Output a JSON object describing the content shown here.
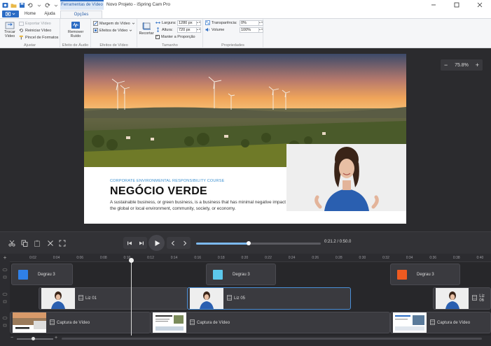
{
  "titlebar": {
    "context_tab": "Ferramentas de Vídeo",
    "app_title": "Novo Projeto - iSpring Cam Pro"
  },
  "tabs": [
    {
      "label": "Home"
    },
    {
      "label": "Ajuda"
    },
    {
      "label": "Opções"
    }
  ],
  "ribbon": {
    "ajustar": {
      "label": "Ajustar",
      "trocar_video": "Trocar Vídeo",
      "exportar_video": "Exportar Vídeo",
      "reiniciar_video": "Reiniciar Vídeo",
      "pincel_formatos": "Pincel de Formatos"
    },
    "efeito_audio": {
      "label": "Efeito de Áudio",
      "remover_ruido": "Remover Ruído"
    },
    "efeitos_video": {
      "label": "Efeitos de Vídeo",
      "margem_video": "Margem do Vídeo",
      "efeitos_video": "Efeitos de Vídeo"
    },
    "tamanho": {
      "label": "Tamanho",
      "recortar": "Recortar",
      "largura_label": "Largura:",
      "largura_value": "1280 px",
      "altura_label": "Altura:",
      "altura_value": "720 px",
      "manter_proporcao": "Manter a Proporção"
    },
    "propriedades": {
      "label": "Propriedades",
      "transparencia_label": "Transparência:",
      "transparencia_value": "0%",
      "volume_label": "Volume",
      "volume_value": "100%"
    }
  },
  "stage": {
    "zoom": "75.8%",
    "slide": {
      "subtitle": "CORPORATE ENVIRONMENTAL RESPONSIBILITY COURSE",
      "title": "NEGÓCIO VERDE",
      "body": "A sustainable business, or green business, is a business that has minimal negative impact on the global or local environment, community, society, or economy."
    }
  },
  "player": {
    "time": "0:21.2 / 0:50.0",
    "progress_fraction": 0.424
  },
  "timeline": {
    "ticks": [
      "0:02",
      "0:04",
      "0:06",
      "0:08",
      "0:10",
      "0:12",
      "0:14",
      "0:16",
      "0:18",
      "0:20",
      "0:22",
      "0:24",
      "0:26",
      "0:28",
      "0:30",
      "0:32",
      "0:34",
      "0:36",
      "0:38",
      "0:40"
    ],
    "track1": [
      {
        "label": "Degrau 3",
        "color": "#2f80e8"
      },
      {
        "label": "Degrau 3",
        "color": "#5cc8ec"
      },
      {
        "label": "Degrau 3",
        "color": "#ee5a20"
      }
    ],
    "track2": [
      {
        "label": "Liz 01"
      },
      {
        "label": "Liz 05"
      },
      {
        "label": "Liz 06"
      }
    ],
    "track3": [
      {
        "label": "Captura de Vídeo"
      },
      {
        "label": "Captura de Vídeo"
      },
      {
        "label": "Captura de Vídeo"
      }
    ]
  },
  "colors": {
    "accent": "#2b6cc4",
    "stage_bg": "#2b2b2e",
    "timeline_bg": "#27272a",
    "slide_title": "#111111",
    "slide_subtitle": "#3a8fd0"
  }
}
